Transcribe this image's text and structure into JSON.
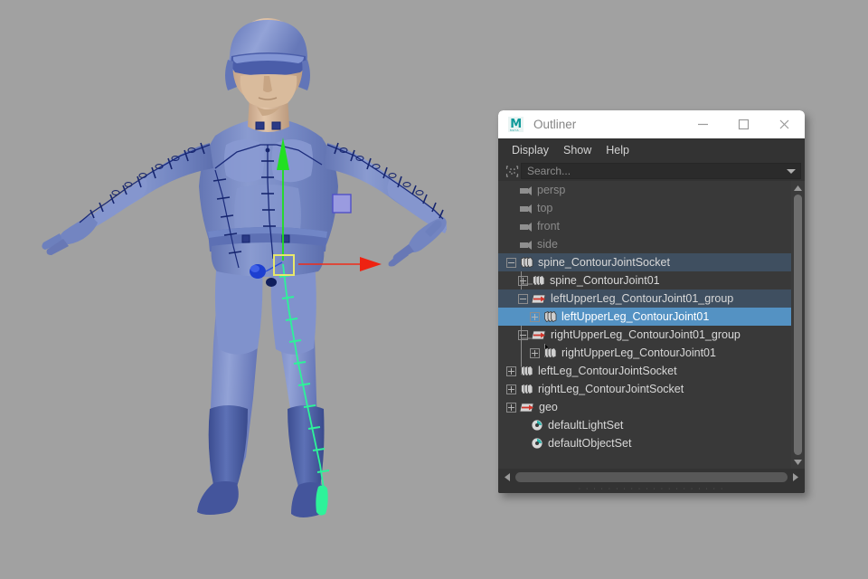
{
  "viewport": {
    "name": "maya-3d-viewport",
    "background_color": "#a1a1a1",
    "description": "3D character model in T-pose with joint chains",
    "manipulator": {
      "x_axis_color": "#ee2211",
      "y_axis_color": "#22dd22",
      "selection_box_color": "#e8e86a"
    },
    "selected_chain_color": "#36f29a",
    "joint_chain_color": "#1a2a7a",
    "skin_color": "#7f92c8",
    "flesh_color": "#d8bca0",
    "dark_suit_color": "#4f63ab"
  },
  "window": {
    "title": "Outliner",
    "logo_letter": "M",
    "logo_sub": "MAYA",
    "buttons": {
      "minimize": "minimize-button",
      "maximize": "maximize-button",
      "close": "close-button"
    }
  },
  "menubar": {
    "items": [
      {
        "label": "Display"
      },
      {
        "label": "Show"
      },
      {
        "label": "Help"
      }
    ]
  },
  "search": {
    "value": "",
    "placeholder": "Search...",
    "icon": "filter-icon",
    "caret": "chevron-down-icon"
  },
  "tree": {
    "rows": [
      {
        "label": "persp",
        "depth": 1,
        "expander": "none",
        "icon": "camera-icon",
        "state": "dim"
      },
      {
        "label": "top",
        "depth": 1,
        "expander": "none",
        "icon": "camera-icon",
        "state": "dim"
      },
      {
        "label": "front",
        "depth": 1,
        "expander": "none",
        "icon": "camera-icon",
        "state": "dim"
      },
      {
        "label": "side",
        "depth": 1,
        "expander": "none",
        "icon": "camera-icon",
        "state": "dim"
      },
      {
        "label": "spine_ContourJointSocket",
        "depth": 1,
        "expander": "minus",
        "icon": "joint-icon",
        "state": "sel-inactive"
      },
      {
        "label": "spine_ContourJoint01",
        "depth": 2,
        "expander": "plus",
        "icon": "joint-icon",
        "state": "normal"
      },
      {
        "label": "leftUpperLeg_ContourJoint01_group",
        "depth": 2,
        "expander": "minus",
        "icon": "transform-icon",
        "state": "sel-inactive"
      },
      {
        "label": "leftUpperLeg_ContourJoint01",
        "depth": 3,
        "expander": "plus",
        "icon": "joint-icon",
        "state": "sel-active"
      },
      {
        "label": "rightUpperLeg_ContourJoint01_group",
        "depth": 2,
        "expander": "minus",
        "icon": "transform-icon",
        "state": "normal"
      },
      {
        "label": "rightUpperLeg_ContourJoint01",
        "depth": 3,
        "expander": "plus",
        "icon": "joint-icon",
        "state": "normal"
      },
      {
        "label": "leftLeg_ContourJointSocket",
        "depth": 1,
        "expander": "plus",
        "icon": "joint-icon",
        "state": "normal"
      },
      {
        "label": "rightLeg_ContourJointSocket",
        "depth": 1,
        "expander": "plus",
        "icon": "joint-icon",
        "state": "normal"
      },
      {
        "label": "geo",
        "depth": 1,
        "expander": "plus",
        "icon": "transform-icon",
        "state": "normal"
      },
      {
        "label": "defaultLightSet",
        "depth": 2,
        "expander": "none",
        "icon": "set-icon",
        "state": "normal"
      },
      {
        "label": "defaultObjectSet",
        "depth": 2,
        "expander": "none",
        "icon": "set-icon",
        "state": "normal"
      }
    ]
  },
  "scrollbars": {
    "vertical": {
      "up": "scroll-up-arrow",
      "down": "scroll-down-arrow"
    },
    "horizontal": {
      "left": "scroll-left-arrow",
      "right": "scroll-right-arrow"
    }
  }
}
